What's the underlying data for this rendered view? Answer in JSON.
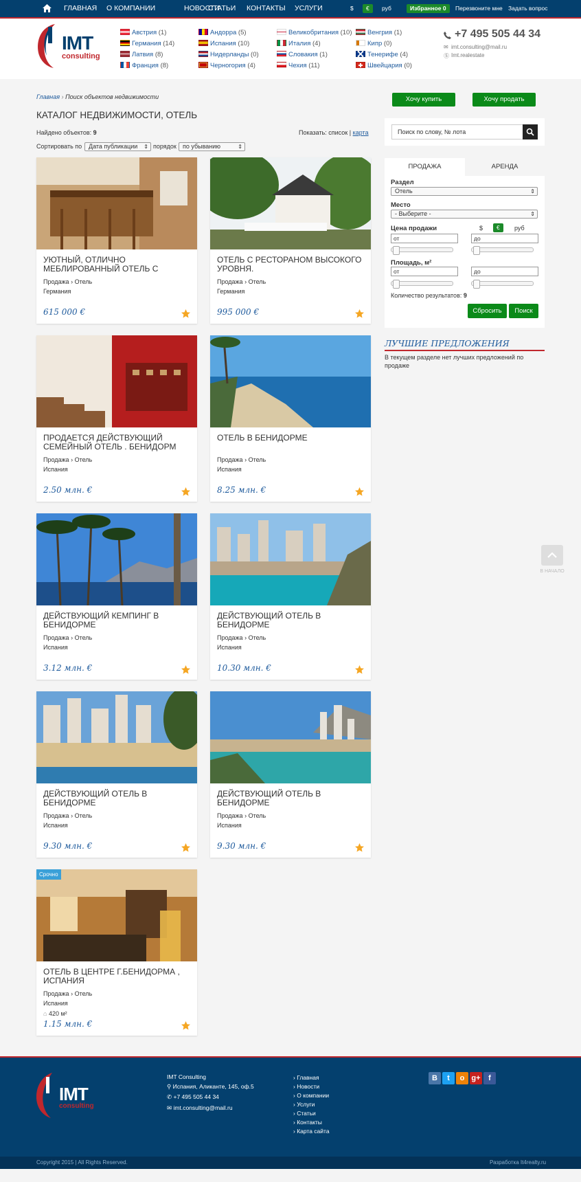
{
  "topnav": {
    "items": [
      "Главная",
      "О компании",
      "Новости",
      "Статьи",
      "Контакты",
      "Услуги"
    ],
    "currencies": [
      "$",
      "€",
      "руб"
    ],
    "favorites": "Избранное 0",
    "callback": "Перезвоните мне",
    "ask": "Задать вопрос"
  },
  "header": {
    "logo_main": "IMT",
    "logo_sub": "consulting",
    "phone": "+7 495 505 44 34",
    "email": "imt.consulting@mail.ru",
    "skype": "Imt.realestate",
    "countries": [
      {
        "name": "Австрия",
        "count": "(1)"
      },
      {
        "name": "Германия",
        "count": "(14)"
      },
      {
        "name": "Латвия",
        "count": "(8)"
      },
      {
        "name": "Франция",
        "count": "(8)"
      },
      {
        "name": "Андорра",
        "count": "(5)"
      },
      {
        "name": "Испания",
        "count": "(10)"
      },
      {
        "name": "Нидерланды",
        "count": "(0)"
      },
      {
        "name": "Черногория",
        "count": "(4)"
      },
      {
        "name": "Великобритания",
        "count": "(10)"
      },
      {
        "name": "Италия",
        "count": "(4)"
      },
      {
        "name": "Словакия",
        "count": "(1)"
      },
      {
        "name": "Чехия",
        "count": "(11)"
      },
      {
        "name": "Венгрия",
        "count": "(1)"
      },
      {
        "name": "Кипр",
        "count": "(0)"
      },
      {
        "name": "Тенерифе",
        "count": "(4)"
      },
      {
        "name": "Швейцария",
        "count": "(0)"
      }
    ]
  },
  "breadcrumb": {
    "home": "Главная",
    "sep": "›",
    "current": "Поиск объектов недвижимости"
  },
  "page_title": "КАТАЛОГ НЕДВИЖИМОСТИ, ОТЕЛЬ",
  "found": {
    "label": "Найдено объектов:",
    "count": "9"
  },
  "view": {
    "label": "Показать:",
    "list": "список",
    "sep": "|",
    "map": "карта"
  },
  "sort": {
    "label": "Сортировать по",
    "field": "Дата публикации",
    "order_label": "порядок",
    "order": "по убыванию"
  },
  "actions": {
    "buy": "Хочу купить",
    "sell": "Хочу продать"
  },
  "search": {
    "placeholder": "Поиск по слову, № лота"
  },
  "filter": {
    "tab_sale": "ПРОДАЖА",
    "tab_rent": "АРЕНДА",
    "section_label": "Раздел",
    "section_value": "Отель",
    "place_label": "Место",
    "place_value": "- Выберите -",
    "price_label": "Цена продажи",
    "cur1": "$",
    "cur2": "€",
    "cur3": "руб",
    "from": "от",
    "to": "до",
    "area_label": "Площадь, м²",
    "results_label": "Количество результатов:",
    "results": "9",
    "reset": "Сбросить",
    "search": "Поиск"
  },
  "best": {
    "title": "ЛУЧШИЕ ПРЕДЛОЖЕНИЯ",
    "text": "В текущем разделе нет лучших предложений по продаже"
  },
  "listings": [
    {
      "title": "УЮТНЫЙ, ОТЛИЧНО МЕБЛИРОВАННЫЙ ОТЕЛЬ С",
      "deal": "Продажа",
      "type": "Отель",
      "country": "Германия",
      "price": "615 000 €"
    },
    {
      "title": "ОТЕЛЬ С РЕСТОРАНОМ ВЫСОКОГО УРОВНЯ.",
      "deal": "Продажа",
      "type": "Отель",
      "country": "Германия",
      "price": "995 000 €"
    },
    {
      "title": "ПРОДАЕТСЯ ДЕЙСТВУЮЩИЙ СЕМЕЙНЫЙ ОТЕЛЬ . БЕНИДОРМ",
      "deal": "Продажа",
      "type": "Отель",
      "country": "Испания",
      "price": "2.50 млн. €"
    },
    {
      "title": "ОТЕЛЬ В БЕНИДОРМЕ",
      "deal": "Продажа",
      "type": "Отель",
      "country": "Испания",
      "price": "8.25 млн. €"
    },
    {
      "title": "ДЕЙСТВУЮЩИЙ КЕМПИНГ В БЕНИДОРМЕ",
      "deal": "Продажа",
      "type": "Отель",
      "country": "Испания",
      "price": "3.12 млн. €"
    },
    {
      "title": "ДЕЙСТВУЮЩИЙ ОТЕЛЬ В БЕНИДОРМЕ",
      "deal": "Продажа",
      "type": "Отель",
      "country": "Испания",
      "price": "10.30 млн. €"
    },
    {
      "title": "ДЕЙСТВУЮЩИЙ ОТЕЛЬ В БЕНИДОРМЕ",
      "deal": "Продажа",
      "type": "Отель",
      "country": "Испания",
      "price": "9.30 млн. €"
    },
    {
      "title": "ДЕЙСТВУЮЩИЙ ОТЕЛЬ В БЕНИДОРМЕ",
      "deal": "Продажа",
      "type": "Отель",
      "country": "Испания",
      "price": "9.30 млн. €"
    },
    {
      "title": "ОТЕЛЬ В ЦЕНТРЕ Г.БЕНИДОРМА , ИСПАНИЯ",
      "deal": "Продажа",
      "type": "Отель",
      "country": "Испания",
      "area": "420 м²",
      "badge": "Срочно",
      "price": "1.15 млн. €"
    }
  ],
  "to_top": "В НАЧАЛО",
  "footer": {
    "company": "IMT Consulting",
    "address": "Испания, Аликанте, 145, оф.5",
    "phone": "+7 495 505 44 34",
    "email": "imt.consulting@mail.ru",
    "links": [
      "Главная",
      "Новости",
      "О компании",
      "Услуги",
      "Статьи",
      "Контакты",
      "Карта сайта"
    ],
    "copyright": "Copyright 2015 | All Rights Reserved.",
    "dev": "Разработка It4realty.ru"
  },
  "colors": {
    "nav": "#04406e",
    "accent": "#c0272d",
    "green": "#0b8a19",
    "link": "#1e5a9c"
  }
}
